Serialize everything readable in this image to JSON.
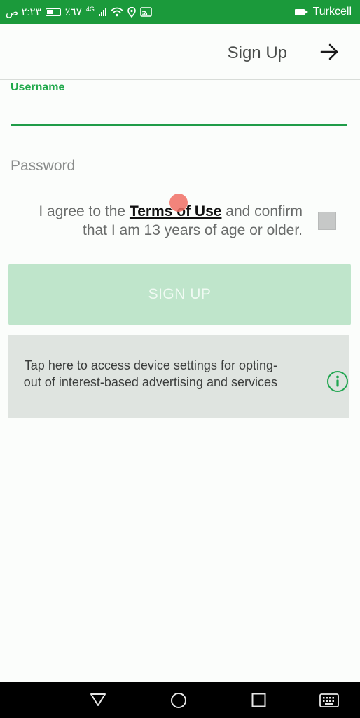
{
  "status_bar": {
    "time": "٢:٢٣ ص",
    "battery_percent": "٪٦٧",
    "network": "4G",
    "carrier": "Turkcell"
  },
  "app_bar": {
    "title": "Sign Up",
    "action_icon": "arrow-right-icon"
  },
  "form": {
    "username_label": "Username",
    "username_value": "",
    "password_placeholder": "Password",
    "password_value": "",
    "terms_prefix": "I agree to the ",
    "terms_link": "Terms of Use",
    "terms_suffix": " and confirm that I am 13 years of age or older.",
    "terms_checked": false,
    "signup_button": "SIGN UP"
  },
  "ad_settings": {
    "text": "Tap here to access device settings for opting-out of interest-based advertising and services",
    "icon": "info-icon"
  },
  "nav_bar": {
    "icons": [
      "back-triangle-icon",
      "home-circle-icon",
      "recents-square-icon",
      "keyboard-icon"
    ]
  },
  "colors": {
    "status_bar": "#1b9a3b",
    "accent": "#1f9c48",
    "button_disabled": "#bfe5cb",
    "panel": "#dfe4e0"
  }
}
